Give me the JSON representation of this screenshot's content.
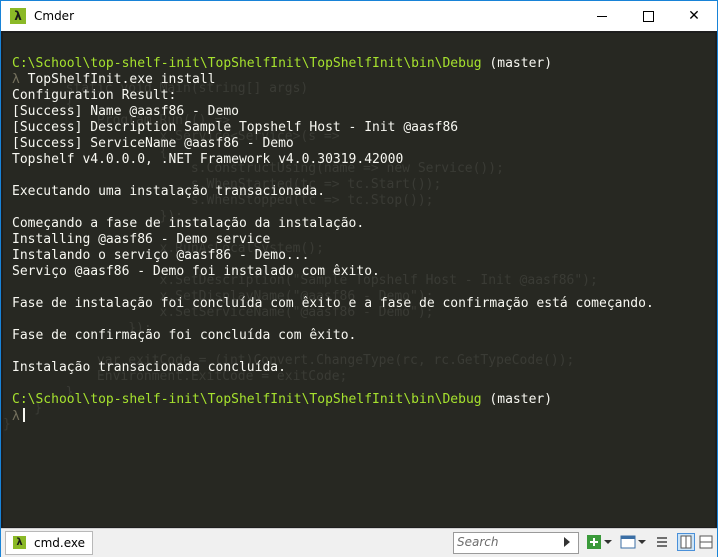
{
  "window": {
    "title": "Cmder",
    "icon": "lambda-icon"
  },
  "console": {
    "lines": [
      {
        "path": "C:\\School\\top-shelf-init\\TopShelfInit\\TopShelfInit\\bin\\Debug",
        "branch": " (master)"
      },
      {
        "prompt": "λ",
        "command": " TopShelfInit.exe install"
      },
      {
        "text": "Configuration Result:"
      },
      {
        "text": "[Success] Name @aasf86 - Demo"
      },
      {
        "text": "[Success] Description Sample Topshelf Host - Init @aasf86"
      },
      {
        "text": "[Success] ServiceName @aasf86 - Demo"
      },
      {
        "text": "Topshelf v4.0.0.0, .NET Framework v4.0.30319.42000"
      },
      {
        "text": ""
      },
      {
        "text": "Executando uma instalação transacionada."
      },
      {
        "text": ""
      },
      {
        "text": "Começando a fase de instalação da instalação."
      },
      {
        "text": "Installing @aasf86 - Demo service"
      },
      {
        "text": "Instalando o serviço @aasf86 - Demo..."
      },
      {
        "text": "Serviço @aasf86 - Demo foi instalado com êxito."
      },
      {
        "text": ""
      },
      {
        "text": "Fase de instalação foi concluída com êxito e a fase de confirmação está começando."
      },
      {
        "text": ""
      },
      {
        "text": "Fase de confirmação foi concluída com êxito."
      },
      {
        "text": ""
      },
      {
        "text": "Instalação transacionada concluída."
      },
      {
        "text": ""
      },
      {
        "path": "C:\\School\\top-shelf-init\\TopShelfInit\\TopShelfInit\\bin\\Debug",
        "branch": " (master)"
      },
      {
        "prompt": "λ",
        "command": ""
      }
    ]
  },
  "statusbar": {
    "tab_label": "cmd.exe",
    "search_placeholder": "Search"
  },
  "colors": {
    "path": "#a6e22e",
    "text": "#f8f8f2",
    "background": "#272822",
    "accent": "#8bb927"
  }
}
